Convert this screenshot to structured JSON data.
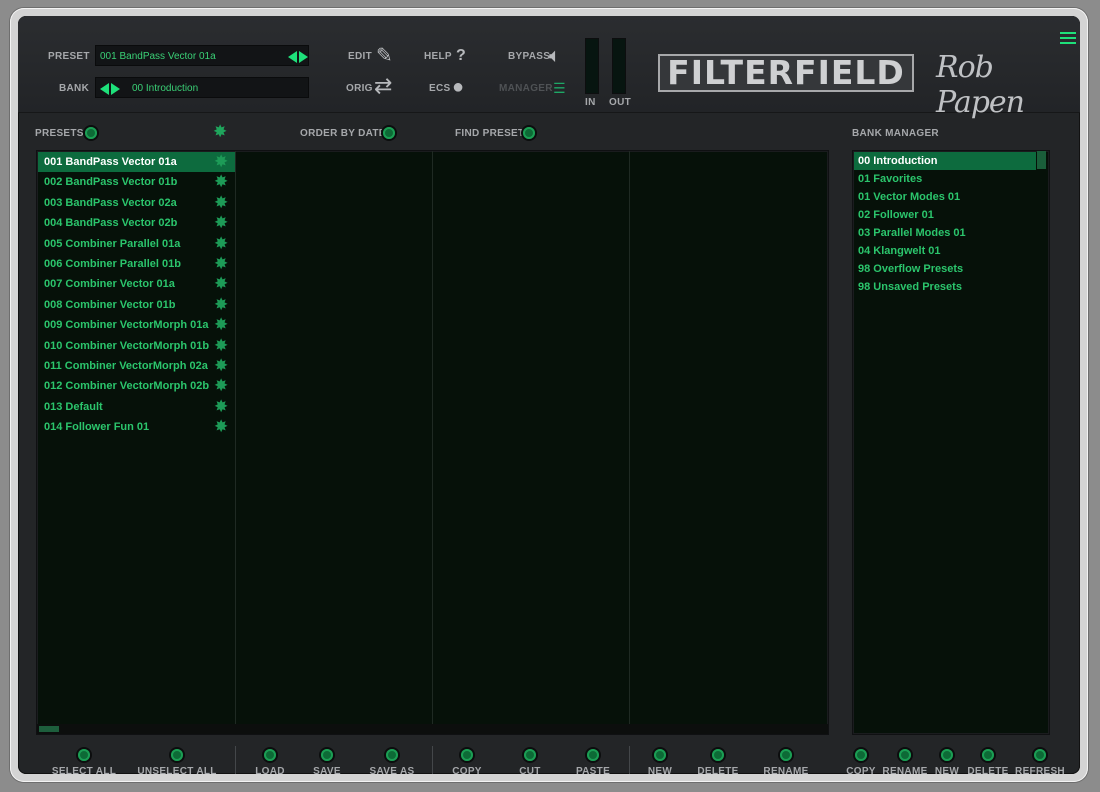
{
  "header": {
    "preset_label": "PRESET",
    "preset_value": "001 BandPass Vector 01a",
    "bank_label": "BANK",
    "bank_value": "00 Introduction",
    "edit_label": "EDIT",
    "help_label": "HELP",
    "help_glyph": "?",
    "bypass_label": "BYPASS",
    "orig_label": "ORIG",
    "ecs_label": "ECS",
    "manager_label": "MANAGER",
    "in_label": "IN",
    "out_label": "OUT",
    "logo_text": "FILTERFIELD",
    "signature": "Rob Papen"
  },
  "toolbar": {
    "presets_label": "PRESETS",
    "order_by_date_label": "ORDER BY DATE",
    "find_preset_label": "FIND PRESET",
    "bank_manager_label": "BANK MANAGER"
  },
  "presets": [
    "001 BandPass Vector 01a",
    "002 BandPass Vector 01b",
    "003 BandPass Vector 02a",
    "004 BandPass Vector 02b",
    "005 Combiner Parallel 01a",
    "006 Combiner Parallel 01b",
    "007 Combiner Vector 01a",
    "008 Combiner Vector 01b",
    "009 Combiner VectorMorph 01a",
    "010 Combiner VectorMorph 01b",
    "011 Combiner VectorMorph 02a",
    "012 Combiner VectorMorph 02b",
    "013 Default",
    "014 Follower Fun 01"
  ],
  "banks": [
    "00 Introduction",
    "01 Favorites",
    "01 Vector Modes 01",
    "02 Follower 01",
    "03 Parallel Modes 01",
    "04 Klangwelt 01",
    "98 Overflow Presets",
    "98 Unsaved Presets"
  ],
  "bottom_buttons": {
    "select_all": "SELECT ALL",
    "unselect_all": "UNSELECT ALL",
    "load": "LOAD",
    "save": "SAVE",
    "save_as": "SAVE AS",
    "copy": "COPY",
    "cut": "CUT",
    "paste": "PASTE",
    "new": "NEW",
    "delete": "DELETE",
    "rename": "RENAME",
    "bank_copy": "COPY",
    "bank_rename": "RENAME",
    "bank_new": "NEW",
    "bank_delete": "DELETE",
    "bank_refresh": "REFRESH"
  },
  "icons": {
    "edit": "pencil-icon",
    "help": "question-icon",
    "bypass": "speaker-icon",
    "orig": "swap-arrows-icon",
    "ecs": "palette-icon",
    "manager": "list-icon",
    "favorite": "star-icon",
    "menu": "hamburger-icon"
  },
  "colors": {
    "accent": "#1ee07a",
    "text_green": "#2bc56c",
    "selection": "#0d6b3e",
    "panel_bg": "#061109",
    "chrome": "#232527"
  }
}
